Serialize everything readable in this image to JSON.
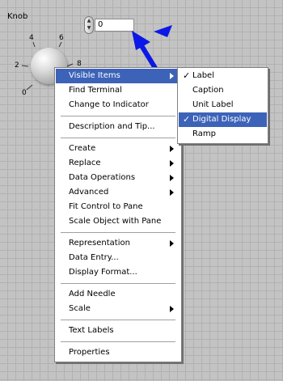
{
  "knob": {
    "label": "Knob",
    "ticks": [
      "0",
      "2",
      "4",
      "6",
      "8"
    ],
    "digital_value": "0"
  },
  "main_menu": {
    "items": [
      {
        "label": "Visible Items",
        "submenu": true,
        "highlighted": true
      },
      {
        "label": "Find Terminal"
      },
      {
        "label": "Change to Indicator"
      },
      {
        "label": "Description and Tip..."
      },
      {
        "label": "Create",
        "submenu": true
      },
      {
        "label": "Replace",
        "submenu": true
      },
      {
        "label": "Data Operations",
        "submenu": true
      },
      {
        "label": "Advanced",
        "submenu": true
      },
      {
        "label": "Fit Control to Pane"
      },
      {
        "label": "Scale Object with Pane"
      },
      {
        "label": "Representation",
        "submenu": true
      },
      {
        "label": "Data Entry..."
      },
      {
        "label": "Display Format..."
      },
      {
        "label": "Add Needle"
      },
      {
        "label": "Scale",
        "submenu": true
      },
      {
        "label": "Text Labels"
      },
      {
        "label": "Properties"
      }
    ]
  },
  "sub_menu": {
    "items": [
      {
        "label": "Label",
        "checked": true
      },
      {
        "label": "Caption",
        "checked": false
      },
      {
        "label": "Unit Label",
        "checked": false
      },
      {
        "label": "Digital Display",
        "checked": true,
        "highlighted": true
      },
      {
        "label": "Ramp",
        "checked": false
      }
    ]
  },
  "icons": {
    "check": "checkmark-icon",
    "submenu_arrow": "chevron-right-icon",
    "annotation_arrow": "blue-arrow-icon"
  },
  "colors": {
    "highlight": "#3c63b8",
    "annotation": "#0b18e6",
    "canvas": "#c3c3c3"
  }
}
